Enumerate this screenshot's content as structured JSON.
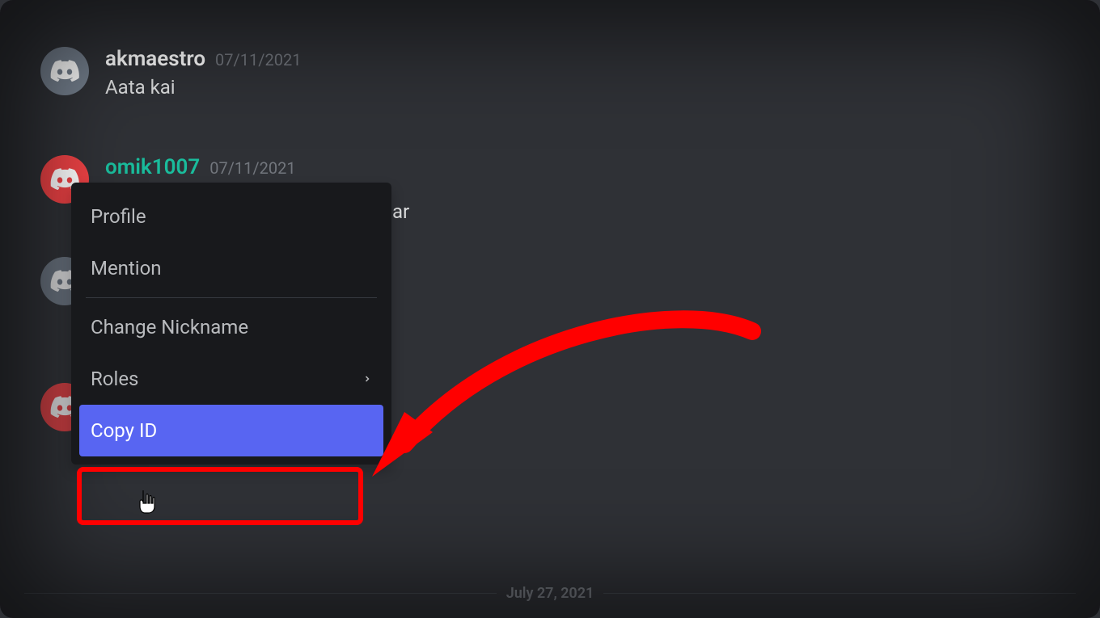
{
  "messages": [
    {
      "username": "akmaestro",
      "timestamp": "07/11/2021",
      "text": "Aata kai",
      "avatarColor": "gray"
    },
    {
      "username": "omik1007",
      "timestamp": "07/11/2021",
      "text": "",
      "avatarColor": "red"
    }
  ],
  "partial_text": "ar",
  "context_menu": {
    "items": [
      {
        "label": "Profile",
        "hasSubmenu": false
      },
      {
        "label": "Mention",
        "hasSubmenu": false
      },
      {
        "label": "Change Nickname",
        "hasSubmenu": false
      },
      {
        "label": "Roles",
        "hasSubmenu": true
      },
      {
        "label": "Copy ID",
        "hasSubmenu": false,
        "highlighted": true
      }
    ]
  },
  "date_divider": "July 27, 2021",
  "colors": {
    "background": "#2f3136",
    "context_bg": "#18191c",
    "highlight": "#5865f2",
    "annotation": "#ff0000",
    "teal": "#1abc9c"
  }
}
